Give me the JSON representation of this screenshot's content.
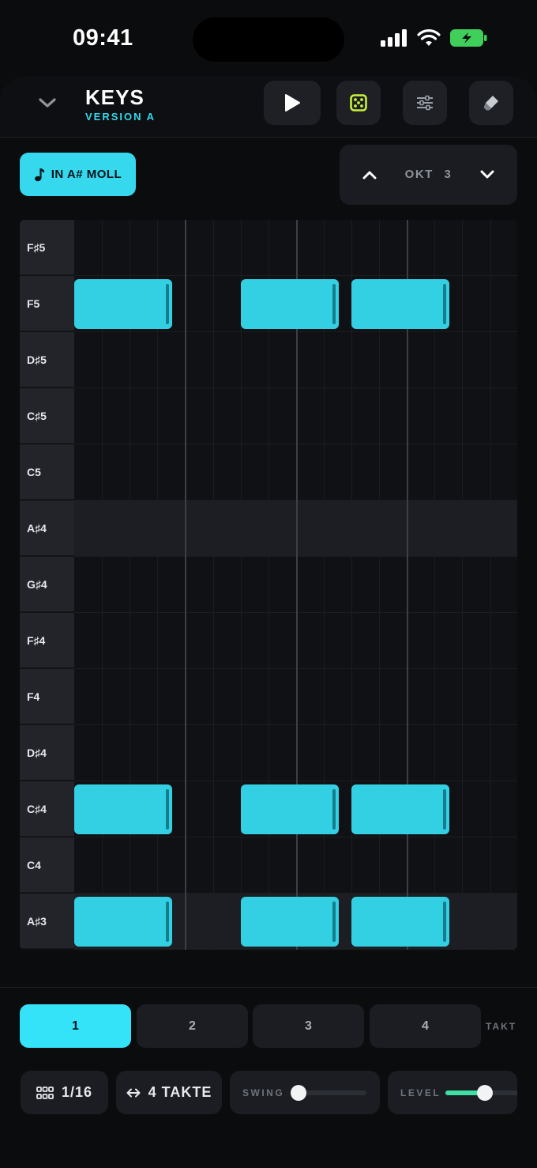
{
  "status": {
    "time": "09:41"
  },
  "header": {
    "title": "KEYS",
    "subtitle": "VERSION A",
    "buttons": [
      "chevron-down-icon",
      "play-icon",
      "dice-icon",
      "sliders-icon",
      "eraser-icon"
    ]
  },
  "scale": {
    "label": "IN A# MOLL"
  },
  "octave": {
    "label": "OKT",
    "value": "3"
  },
  "piano_roll": {
    "keys": [
      "F♯5",
      "F5",
      "D♯5",
      "C♯5",
      "C5",
      "A♯4",
      "G♯4",
      "F♯4",
      "F4",
      "D♯4",
      "C♯4",
      "C4",
      "A♯3"
    ],
    "shaded_rows": [
      "A♯4",
      "A♯3"
    ],
    "steps": 16,
    "notes": [
      {
        "key": "F5",
        "start": 0,
        "length": 4
      },
      {
        "key": "F5",
        "start": 6,
        "length": 4
      },
      {
        "key": "F5",
        "start": 10,
        "length": 4
      },
      {
        "key": "C♯4",
        "start": 0,
        "length": 4
      },
      {
        "key": "C♯4",
        "start": 6,
        "length": 4
      },
      {
        "key": "C♯4",
        "start": 10,
        "length": 4
      },
      {
        "key": "A♯3",
        "start": 0,
        "length": 4
      },
      {
        "key": "A♯3",
        "start": 6,
        "length": 4
      },
      {
        "key": "A♯3",
        "start": 10,
        "length": 4
      }
    ]
  },
  "takt": {
    "items": [
      "1",
      "2",
      "3",
      "4"
    ],
    "active": "1",
    "caption": "TAKT"
  },
  "controls": {
    "grid_value": "1/16",
    "length_value": "4 TAKTE",
    "swing_label": "SWING",
    "swing_value": 0,
    "level_label": "LEVEL",
    "level_value": 0.5
  },
  "colors": {
    "accent": "#35d8ec",
    "note": "#33cfe3",
    "level": "#3fe0a3",
    "dice": "#c7f03a"
  }
}
